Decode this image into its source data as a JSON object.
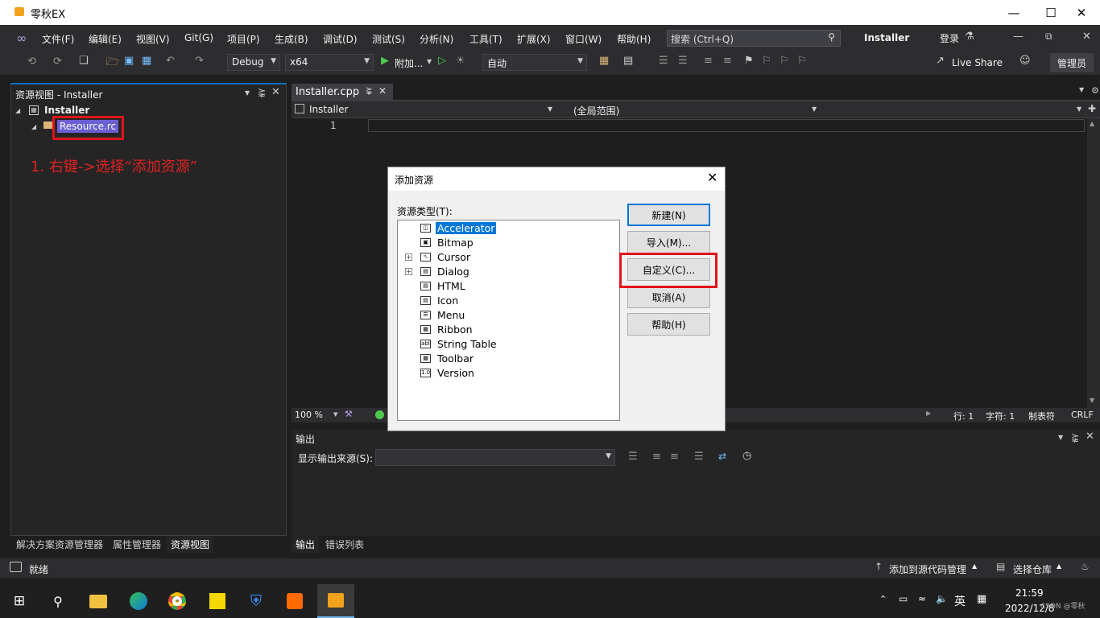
{
  "window": {
    "title": "零秋EX"
  },
  "menu": [
    "文件(F)",
    "编辑(E)",
    "视图(V)",
    "Git(G)",
    "项目(P)",
    "生成(B)",
    "调试(D)",
    "测试(S)",
    "分析(N)",
    "工具(T)",
    "扩展(X)",
    "窗口(W)",
    "帮助(H)"
  ],
  "search": {
    "placeholder": "搜索 (Ctrl+Q)"
  },
  "solution_name": "Installer",
  "login": "登录",
  "toolbar": {
    "config": "Debug",
    "platform": "x64",
    "attach": "附加...",
    "auto": "自动",
    "live_share": "Live Share",
    "admin": "管理员"
  },
  "side_panel": {
    "title": "资源视图 - Installer",
    "root": "Installer",
    "child": "Resource.rc",
    "tabs": [
      "解决方案资源管理器",
      "属性管理器",
      "资源视图"
    ]
  },
  "annotation": "1. 右键->选择“添加资源”",
  "editor": {
    "tab": "Installer.cpp",
    "nav_project": "Installer",
    "nav_scope": "(全局范围)",
    "line_number": "1",
    "zoom": "100 %",
    "line": "行: 1",
    "char": "字符: 1",
    "tabs_mode": "制表符",
    "eol": "CRLF"
  },
  "output": {
    "title": "输出",
    "source_label": "显示输出来源(S):",
    "tabs": [
      "输出",
      "错误列表"
    ]
  },
  "status": {
    "ready": "就绪",
    "add_source": "添加到源代码管理",
    "select_repo": "选择仓库"
  },
  "dialog": {
    "title": "添加资源",
    "type_label": "资源类型(T):",
    "types": [
      {
        "label": "Accelerator",
        "icon": "accelerator-icon",
        "selected": true,
        "expandable": false
      },
      {
        "label": "Bitmap",
        "icon": "bitmap-icon",
        "selected": false,
        "expandable": false
      },
      {
        "label": "Cursor",
        "icon": "cursor-icon",
        "selected": false,
        "expandable": true
      },
      {
        "label": "Dialog",
        "icon": "dialog-icon",
        "selected": false,
        "expandable": true
      },
      {
        "label": "HTML",
        "icon": "html-icon",
        "selected": false,
        "expandable": false
      },
      {
        "label": "Icon",
        "icon": "icon-resource-icon",
        "selected": false,
        "expandable": false
      },
      {
        "label": "Menu",
        "icon": "menu-icon",
        "selected": false,
        "expandable": false
      },
      {
        "label": "Ribbon",
        "icon": "ribbon-icon",
        "selected": false,
        "expandable": false
      },
      {
        "label": "String Table",
        "icon": "string-table-icon",
        "selected": false,
        "expandable": false
      },
      {
        "label": "Toolbar",
        "icon": "toolbar-icon",
        "selected": false,
        "expandable": false
      },
      {
        "label": "Version",
        "icon": "version-icon",
        "selected": false,
        "expandable": false
      }
    ],
    "buttons": {
      "new": "新建(N)",
      "import": "导入(M)...",
      "custom": "自定义(C)...",
      "cancel": "取消(A)",
      "help": "帮助(H)"
    }
  },
  "taskbar": {
    "ime": "英",
    "time": "21:59",
    "date": "2022/12/8",
    "watermark": "CSDN @零秋"
  },
  "colors": {
    "accent": "#0e70c0",
    "highlight": "#e0141e",
    "selection": "#0078d7"
  }
}
